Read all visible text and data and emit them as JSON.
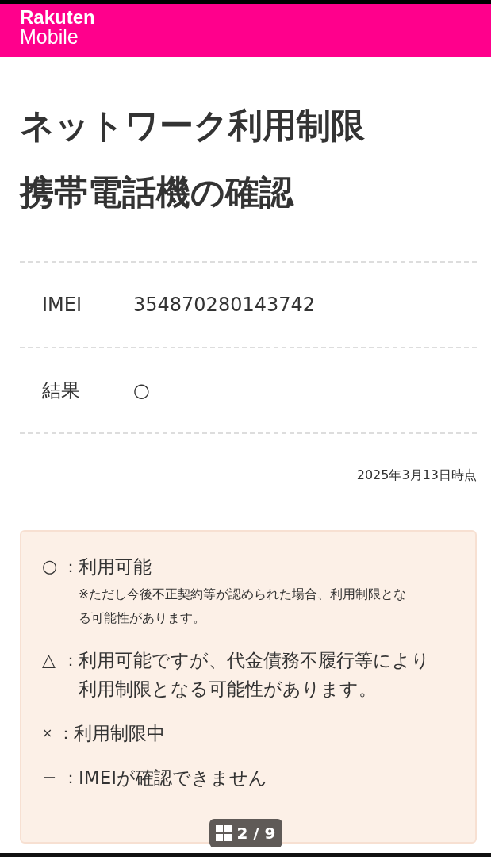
{
  "header": {
    "logo_top": "Rakuten",
    "logo_bottom": "Mobile"
  },
  "title_lines": [
    "ネットワーク利用制限",
    "携帯電話機の確認"
  ],
  "rows": [
    {
      "label": "IMEI",
      "value": "354870280143742"
    },
    {
      "label": "結果",
      "value": "○"
    }
  ],
  "as_of": "2025年3月13日時点",
  "legend": [
    {
      "symbol": "○",
      "separator": "：",
      "text": "利用可能",
      "note": "※ただし今後不正契約等が認められた場合、利用制限となる可能性があります。"
    },
    {
      "symbol": "△",
      "separator": "：",
      "text": "利用可能ですが、代金債務不履行等により利用制限となる可能性があります。"
    },
    {
      "symbol": "×",
      "separator": "：",
      "text": "利用制限中"
    },
    {
      "symbol": "−",
      "separator": "：",
      "text": "IMEIが確認できません"
    }
  ],
  "viewer": {
    "counter": "2 / 9"
  }
}
